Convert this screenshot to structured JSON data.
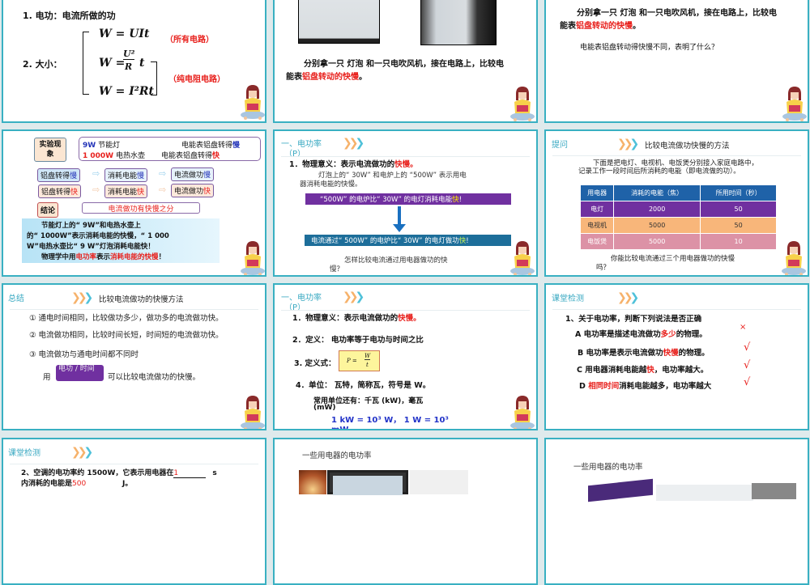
{
  "slides": [
    {
      "line1": "1. 电功：电流所做的功",
      "line2": "2. 大小：",
      "formula1": "W = UIt",
      "formula2_lhs": "W =",
      "formula2_num": "U²",
      "formula2_den": "R",
      "formula2_t": "t",
      "formula3": "W = I²Rt",
      "note1": "（所有电路）",
      "note2": "（纯电阻电路）"
    },
    {
      "text_a": "分别拿一只 灯泡 和一只电吹风机，接在电路上，比较电",
      "text_b_pre": "能表",
      "text_b_red": "铝盘转动的快慢",
      "text_b_post": "。"
    },
    {
      "text_a": "分别拿一只 灯泡 和一只电吹风机，接在电路上，比较电",
      "text_b_pre": "能表",
      "text_b_red": "铝盘转动的快慢",
      "text_b_post": "。",
      "question": "电能表铝盘转动得快慢不同，表明了什么？"
    },
    {
      "label_exp": "实验现象",
      "obs1_a": "9W",
      "obs1_b": " 节能灯",
      "obs1_c": "电能表铝盘转得",
      "obs1_d": "慢",
      "obs2_a": "1 000W",
      "obs2_b": " 电热水壶",
      "obs2_c": "电能表铝盘转得",
      "obs2_d": "快",
      "chain_slow": [
        {
          "t": "铝盘转得",
          "k": "慢"
        },
        {
          "t": "消耗电能",
          "k": "慢"
        },
        {
          "t": "电流做功",
          "k": "慢"
        }
      ],
      "chain_fast": [
        {
          "t": "铝盘转得",
          "k": "快"
        },
        {
          "t": "消耗电能",
          "k": "快"
        },
        {
          "t": "电流做功",
          "k": "快"
        }
      ],
      "label_conc": "结论",
      "conclusion": "电流做功有快慢之分",
      "p1": "节能灯上的“ 9W”和电热水壶上",
      "p2": "的“ 1000W”表示消耗电能的快慢，“ 1 000",
      "p3": "W”电热水壶比“ 9 W”灯泡消耗电能快！",
      "p4_a": "物理学中用",
      "p4_b": "电功率",
      "p4_c": "表示",
      "p4_d": "消耗电能的快慢",
      "p4_e": "！"
    },
    {
      "header": "一、电功率",
      "header_p": "（P）",
      "item1_a": "1．物理意义：表示电流做功的",
      "item1_b": "快慢。",
      "text1": "灯泡上的“ 30W” 和电炉上的 “500W” 表示用电",
      "text2": "器消耗电能的快慢。",
      "bar1_a": "“500W” 的电炉比“ 30W” 的电灯消耗电能",
      "bar1_b": "快",
      "bar1_c": "!",
      "bar2_a": "电流通过“ 500W” 的电炉比“ 30W” 的电灯做功",
      "bar2_b": "快",
      "bar2_c": "!",
      "question_a": "怎样比较电流通过用电器做功的快",
      "question_b": "慢？"
    },
    {
      "header": "提问",
      "title": "比较电流做功快慢的方法",
      "intro1": "下面是把电灯、电视机、电饭煲分别接入家庭电路中，",
      "intro2": "记录工作一段时间后所消耗的电能（即电流做的功）。",
      "table_headers": [
        "用电器",
        "消耗的电能（焦）",
        "所用时间（秒）"
      ],
      "table_rows": [
        [
          "电灯",
          "2000",
          "50"
        ],
        [
          "电视机",
          "5000",
          "50"
        ],
        [
          "电饭煲",
          "5000",
          "10"
        ]
      ],
      "row_colors": [
        "#7030a0",
        "#f8b67a",
        "#dc92a6"
      ],
      "question_a": "你能比较电流通过三个用电器做功的快慢",
      "question_b": "吗？"
    },
    {
      "header": "总结",
      "title": "比较电流做功的快慢方法",
      "item1": "① 通电时间相同，比较做功多少，做功多的电流做功快。",
      "item2": "② 电流做功相同，比较时间长短，时间短的电流做功快。",
      "item3": "③ 电流做功与通电时间都不同时",
      "use": "用",
      "chip": "电功 / 时间",
      "tail": "可以比较电流做功的快慢。"
    },
    {
      "header": "一、电功率",
      "header_p": "（P）",
      "item1_a": "1．物理意义：表示电流做功的",
      "item1_b": "快慢。",
      "item2": "2．定义： 电功率等于电功与时间之比",
      "item3": "3. 定义式：",
      "formula_lhs": "P =",
      "formula_num": "W",
      "formula_den": "t",
      "item4": "4．单位： 瓦特，简称瓦，符号是 W。",
      "item5": "常用单位还有：千瓦 (kW)，毫瓦",
      "item5b": "(mW)",
      "item6": "1 kW = 10³ W， 1 W = 10³",
      "item6b": "mW"
    },
    {
      "header": "课堂检测",
      "q": "1、关于电功率，判断下列说法是否正确",
      "options": [
        {
          "pre": "A  电功率是描述电流做功",
          "red": "多少",
          "post": "的物理。",
          "mark": "×"
        },
        {
          "pre": "B  电功率是表示电流做功",
          "red": "快慢",
          "post": "的物理。",
          "mark": "√"
        },
        {
          "pre": "C 用电器消耗电能越",
          "red": "快",
          "post": "，电功率越大。",
          "mark": "√"
        },
        {
          "pre": "D ",
          "red": "相同时间",
          "post": "消耗电能越多，电功率越大",
          "mark": "√"
        }
      ]
    },
    {
      "header": "课堂检测",
      "q_a": "2、空调的电功率约 1500W，它表示用电器在",
      "ans1": "1",
      "q_b": "s",
      "q_c": "内消耗的电能是",
      "ans2": "500",
      "q_d": "J。"
    },
    {
      "title": "一些用电器的电功率"
    },
    {
      "title": "一些用电器的电功率"
    }
  ]
}
